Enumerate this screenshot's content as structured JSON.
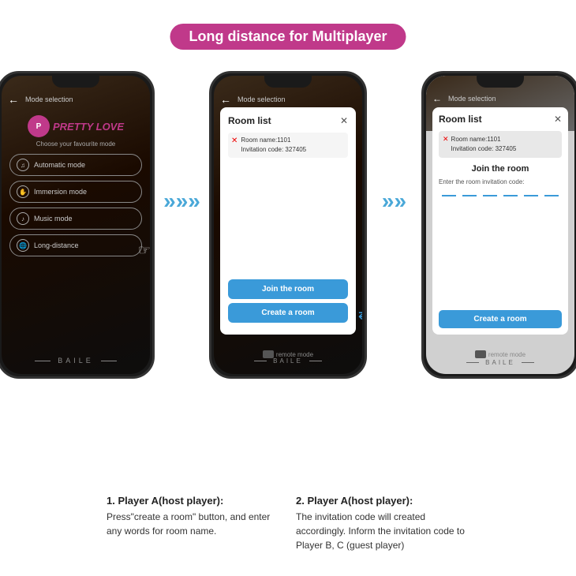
{
  "title": "Long distance for Multiplayer",
  "phones": {
    "phone1": {
      "topLabel": "Mode selection",
      "logoText": "PRETTY LOVE",
      "chooseLabel": "Choose your favourite mode",
      "menuItems": [
        {
          "icon": "♫",
          "label": "Automatic mode"
        },
        {
          "icon": "✋",
          "label": "Immersion mode"
        },
        {
          "icon": "♪",
          "label": "Music mode"
        },
        {
          "icon": "🌐",
          "label": "Long-distance"
        }
      ],
      "baile": "BAILE"
    },
    "phone2": {
      "topLabel": "Mode selection",
      "dialog": {
        "title": "Room list",
        "roomName": "Room name:1101",
        "invitationCode": "Invitation code: 327405",
        "joinBtn": "Join the room",
        "createBtn": "Create a room"
      },
      "remoteLabel": "remote mode",
      "baile": "BAILE"
    },
    "phone3": {
      "topLabel": "Mode selection",
      "dialog": {
        "title": "Room list",
        "roomName": "Room name:1101",
        "invitationCode": "Invitation code: 327405",
        "joinRoomTitle": "Join the room",
        "enterCodeLabel": "Enter the room invitation code:",
        "createBtn": "Create a room"
      },
      "remoteLabel": "remote mode",
      "baile": "BAILE"
    }
  },
  "arrows": {
    "symbol": "»»»"
  },
  "descriptions": [
    {
      "number": "1. Player A(host player):",
      "text": "Press\"create a room\" button, and enter any words for room name."
    },
    {
      "number": "2. Player A(host player):",
      "text": "The invitation code will created accordingly. Inform the invitation code to Player B, C (guest player)"
    }
  ]
}
